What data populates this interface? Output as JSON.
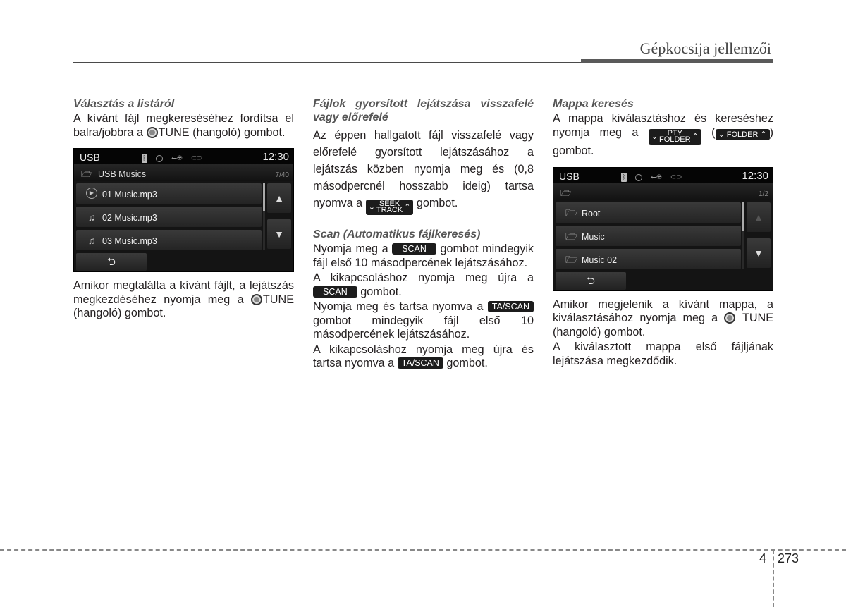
{
  "header": {
    "title": "Gépkocsija jellemzői"
  },
  "col1": {
    "heading": "Választás a listáról",
    "p1_before": "A kívánt fájl megkereséséhez fordítsa el balra/jobbra a",
    "p1_knob": "TUNE",
    "p1_after": "(hangoló) gombot.",
    "screen": {
      "source": "USB",
      "time": "12:30",
      "folder": "USB Musics",
      "page": "7/40",
      "rows": [
        {
          "icon": "play-icon",
          "label": "01 Music.mp3"
        },
        {
          "icon": "music-note-icon",
          "label": "02 Music.mp3"
        },
        {
          "icon": "music-note-icon",
          "label": "03 Music.mp3"
        }
      ]
    },
    "p2_before": "Amikor megtalálta a kívánt fájlt, a lejátszás megkezdéséhez nyomja meg a",
    "p2_knob": "TUNE",
    "p2_after": "(hangoló) gombot."
  },
  "col2": {
    "heading1": "Fájlok gyorsított lejátszása visszafelé vagy előrefelé",
    "p1_before": "Az éppen hallgatott fájl visszafelé vagy előrefelé gyorsított lejátszásához a lejátszás közben nyomja meg és (0,8 másodpercnél hosszabb ideig) tartsa nyomva a",
    "seek_top": "SEEK",
    "seek_bottom": "TRACK",
    "p1_after": "gombot.",
    "heading2": "Scan (Automatikus fájlkeresés)",
    "p2_before": "Nyomja meg a",
    "scan_label": "SCAN",
    "p2_after": "gombot mindegyik fájl első 10 másodpercének lejátszásához.",
    "p3_before": "A kikapcsoláshoz nyomja meg újra a",
    "p3_after": "gombot.",
    "p4_before": "Nyomja meg és tartsa nyomva a",
    "tascan_label": "TA/SCAN",
    "p4_after": "gombot mindegyik fájl első 10 másodpercének lejátszásához.",
    "p5_before": "A kikapcsoláshoz nyomja meg újra és tartsa nyomva a",
    "p5_after": "gombot."
  },
  "col3": {
    "heading": "Mappa keresés",
    "p1_before": "A mappa kiválasztáshoz és kereséshez nyomja meg a",
    "pty_top": "PTY",
    "pty_bottom": "FOLDER",
    "folder_label": "FOLDER",
    "p1_after": "gombot.",
    "screen": {
      "source": "USB",
      "time": "12:30",
      "folder": "",
      "page": "1/2",
      "rows": [
        {
          "icon": "folder-icon",
          "label": "Root"
        },
        {
          "icon": "folder-icon",
          "label": "Music"
        },
        {
          "icon": "folder-icon",
          "label": "Music 02"
        }
      ]
    },
    "p2_before": "Amikor megjelenik a kívánt mappa, a kiválasztásához nyomja meg a",
    "p2_knob": "TUNE",
    "p2_after": "(hangoló) gombot.",
    "p3": "A kiválasztott mappa első fájljának lejátszása megkezdődik."
  },
  "footer": {
    "chapter": "4",
    "page": "273"
  }
}
